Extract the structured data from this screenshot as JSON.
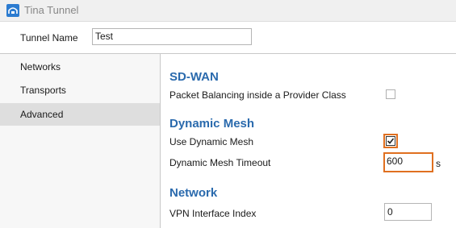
{
  "window": {
    "title": "Tina Tunnel",
    "icon": "tunnel-app-icon"
  },
  "tunnel_name": {
    "label": "Tunnel Name",
    "value": "Test"
  },
  "sidebar": {
    "items": [
      {
        "label": "Networks",
        "selected": false
      },
      {
        "label": "Transports",
        "selected": false
      },
      {
        "label": "Advanced",
        "selected": true
      }
    ]
  },
  "sdwan": {
    "title": "SD-WAN",
    "packet_balancing": {
      "label": "Packet Balancing inside a Provider Class",
      "checked": false
    }
  },
  "dynamic_mesh": {
    "title": "Dynamic Mesh",
    "use": {
      "label": "Use Dynamic Mesh",
      "checked": true
    },
    "timeout": {
      "label": "Dynamic Mesh Timeout",
      "value": "600",
      "unit": "s"
    }
  },
  "network": {
    "title": "Network",
    "vpn_index": {
      "label": "VPN Interface Index",
      "value": "0"
    }
  },
  "colors": {
    "accent_heading": "#2a6aad",
    "highlight": "#e07020",
    "selected_nav": "#dedede"
  }
}
